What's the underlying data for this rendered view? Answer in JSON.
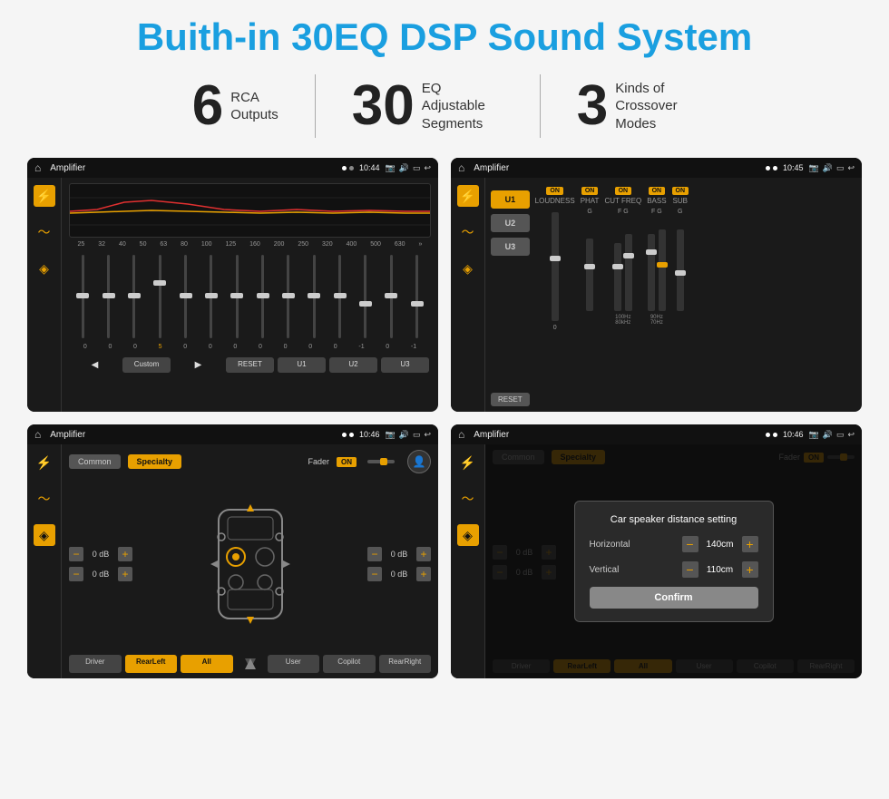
{
  "page": {
    "title": "Buith-in 30EQ DSP Sound System",
    "background": "#f5f5f5"
  },
  "stats": [
    {
      "number": "6",
      "label_line1": "RCA",
      "label_line2": "Outputs"
    },
    {
      "number": "30",
      "label_line1": "EQ Adjustable",
      "label_line2": "Segments"
    },
    {
      "number": "3",
      "label_line1": "Kinds of",
      "label_line2": "Crossover Modes"
    }
  ],
  "screens": [
    {
      "id": "screen1",
      "status_bar": {
        "title": "Amplifier",
        "time": "10:44"
      },
      "eq_labels": [
        "25",
        "32",
        "40",
        "50",
        "63",
        "80",
        "100",
        "125",
        "160",
        "200",
        "250",
        "320",
        "400",
        "500",
        "630"
      ],
      "eq_values": [
        "0",
        "0",
        "0",
        "5",
        "0",
        "0",
        "0",
        "0",
        "0",
        "0",
        "0",
        "-1",
        "0",
        "-1",
        ""
      ],
      "buttons": [
        "Custom",
        "RESET",
        "U1",
        "U2",
        "U3"
      ]
    },
    {
      "id": "screen2",
      "status_bar": {
        "title": "Amplifier",
        "time": "10:45"
      },
      "presets": [
        "U1",
        "U2",
        "U3"
      ],
      "channels": [
        "LOUDNESS",
        "PHAT",
        "CUT FREQ",
        "BASS",
        "SUB"
      ],
      "reset_label": "RESET"
    },
    {
      "id": "screen3",
      "status_bar": {
        "title": "Amplifier",
        "time": "10:46"
      },
      "tabs": [
        "Common",
        "Specialty"
      ],
      "fader_label": "Fader",
      "fader_on": "ON",
      "controls": {
        "vol1": "0 dB",
        "vol2": "0 dB",
        "vol3": "0 dB",
        "vol4": "0 dB"
      },
      "buttons": [
        "Driver",
        "RearLeft",
        "All",
        "User",
        "Copilot",
        "RearRight"
      ]
    },
    {
      "id": "screen4",
      "status_bar": {
        "title": "Amplifier",
        "time": "10:46"
      },
      "tabs": [
        "Common",
        "Specialty"
      ],
      "dialog": {
        "title": "Car speaker distance setting",
        "horizontal_label": "Horizontal",
        "horizontal_value": "140cm",
        "vertical_label": "Vertical",
        "vertical_value": "110cm",
        "confirm_label": "Confirm"
      },
      "controls": {
        "vol1": "0 dB",
        "vol2": "0 dB"
      },
      "buttons": [
        "Driver",
        "RearLeft",
        "All",
        "User",
        "Copilot",
        "RearRight"
      ]
    }
  ]
}
